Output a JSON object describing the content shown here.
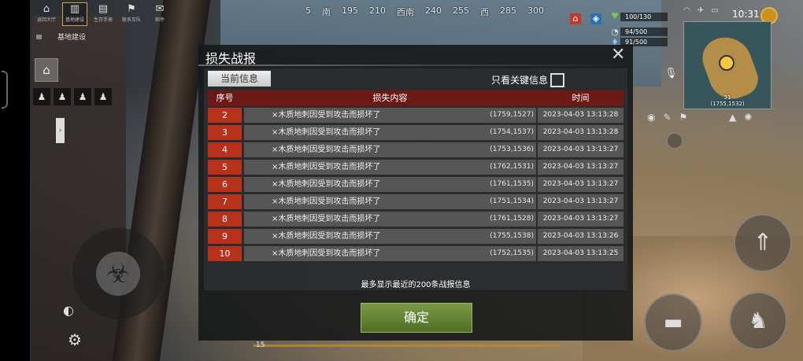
{
  "hud": {
    "top_menu": [
      {
        "label": "返回大厅",
        "icon": "home-icon",
        "selected": false
      },
      {
        "label": "基地建设",
        "icon": "build-icon",
        "selected": true
      },
      {
        "label": "生存手册",
        "icon": "book-icon",
        "selected": false
      },
      {
        "label": "联系车队",
        "icon": "team-icon",
        "selected": false
      },
      {
        "label": "邮件",
        "icon": "mail-icon",
        "selected": false
      }
    ],
    "compass": [
      "5",
      "南",
      "195",
      "210",
      "西南",
      "240",
      "255",
      "西",
      "285",
      "300"
    ],
    "subtitle": "基地建设",
    "time": "10:31",
    "health": "100/130",
    "food": "94/500",
    "water": "91/500",
    "minimap_label_top": "31",
    "minimap_coords": "(1755,1532)",
    "xp_level": "15"
  },
  "dialog": {
    "title": "损失战报",
    "tab_current": "当前信息",
    "key_only_label": "只看关键信息",
    "key_only_checked": false,
    "columns": {
      "index": "序号",
      "content": "损失内容",
      "time": "时间"
    },
    "rows": [
      {
        "index": "2",
        "content": "×木质地刺因受到攻击而损坏了",
        "coords": "(1759,1527)",
        "time": "2023-04-03 13:13:28"
      },
      {
        "index": "3",
        "content": "×木质地刺因受到攻击而损坏了",
        "coords": "(1754,1537)",
        "time": "2023-04-03 13:13:28"
      },
      {
        "index": "4",
        "content": "×木质地刺因受到攻击而损坏了",
        "coords": "(1753,1536)",
        "time": "2023-04-03 13:13:27"
      },
      {
        "index": "5",
        "content": "×木质地刺因受到攻击而损坏了",
        "coords": "(1762,1531)",
        "time": "2023-04-03 13:13:27"
      },
      {
        "index": "6",
        "content": "×木质地刺因受到攻击而损坏了",
        "coords": "(1761,1535)",
        "time": "2023-04-03 13:13:27"
      },
      {
        "index": "7",
        "content": "×木质地刺因受到攻击而损坏了",
        "coords": "(1751,1534)",
        "time": "2023-04-03 13:13:27"
      },
      {
        "index": "8",
        "content": "×木质地刺因受到攻击而损坏了",
        "coords": "(1761,1528)",
        "time": "2023-04-03 13:13:27"
      },
      {
        "index": "9",
        "content": "×木质地刺因受到攻击而损坏了",
        "coords": "(1755,1538)",
        "time": "2023-04-03 13:13:26"
      },
      {
        "index": "10",
        "content": "×木质地刺因受到攻击而损坏了",
        "coords": "(1752,1535)",
        "time": "2023-04-03 13:13:25"
      }
    ],
    "footnote": "最多显示最近的200条战报信息",
    "confirm_label": "确定",
    "close_icon": "close-icon"
  }
}
